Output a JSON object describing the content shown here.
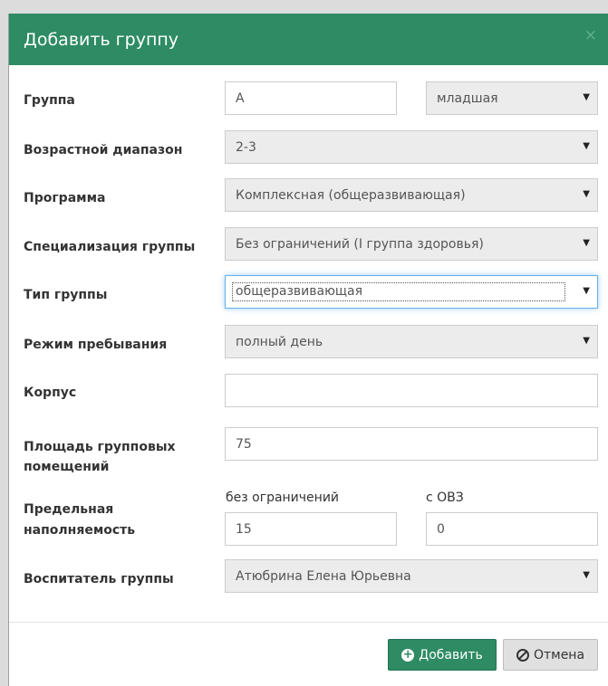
{
  "modal": {
    "title": "Добавить группу",
    "close": "×"
  },
  "fields": {
    "group": {
      "label": "Группа",
      "value": "А",
      "age_select": "младшая"
    },
    "age_range": {
      "label": "Возрастной диапазон",
      "value": "2-3"
    },
    "program": {
      "label": "Программа",
      "value": "Комплексная (общеразвивающая)"
    },
    "specialization": {
      "label": "Специализация группы",
      "value": "Без ограничений (I группа здоровья)"
    },
    "group_type": {
      "label": "Тип группы",
      "value": "общеразвивающая"
    },
    "stay_mode": {
      "label": "Режим пребывания",
      "value": "полный день"
    },
    "building": {
      "label": "Корпус",
      "value": ""
    },
    "area": {
      "label_line1": "Площадь групповых",
      "label_line2": "помещений",
      "value": "75"
    },
    "capacity": {
      "label_line1": "Предельная",
      "label_line2": "наполняемость",
      "unlimited_label": "без ограничений",
      "unlimited_value": "15",
      "ovz_label": "с ОВЗ",
      "ovz_value": "0"
    },
    "teacher": {
      "label": "Воспитатель группы",
      "value": "Атюбрина Елена Юрьевна"
    }
  },
  "buttons": {
    "add": "Добавить",
    "cancel": "Отмена"
  },
  "colors": {
    "header": "#2e8b63",
    "add_button": "#2e8b63"
  }
}
